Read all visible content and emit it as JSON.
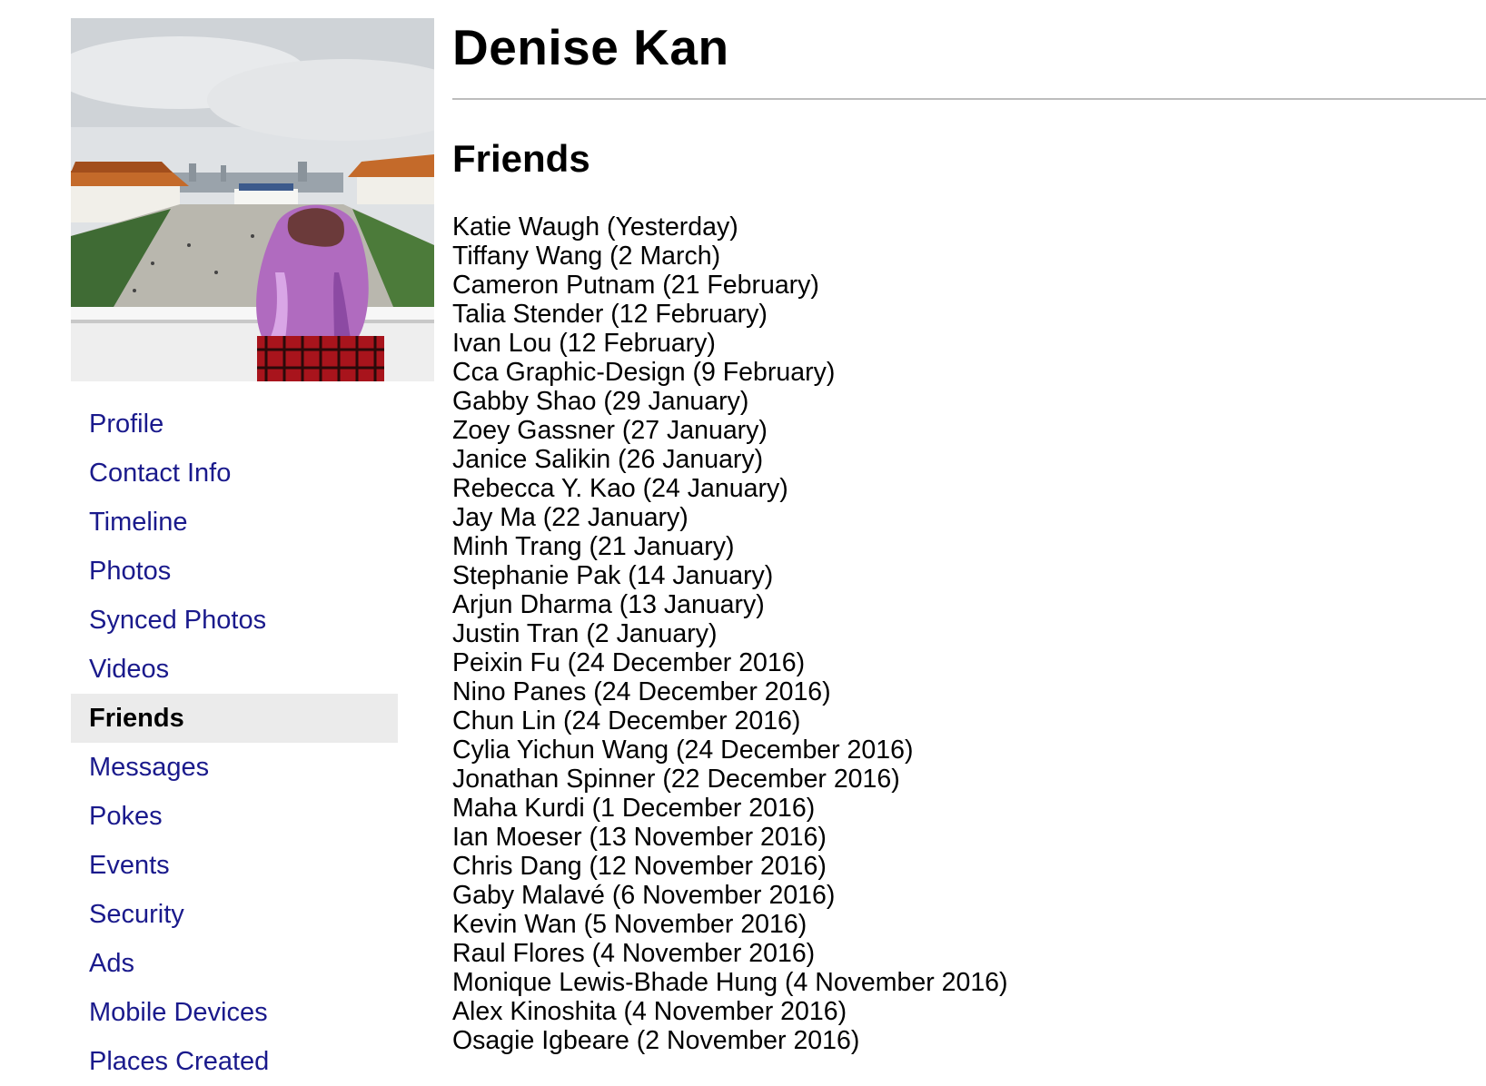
{
  "profile": {
    "name": "Denise Kan",
    "photo_icon": "profile-photo"
  },
  "sidebar": {
    "items": [
      {
        "label": "Profile",
        "active": false
      },
      {
        "label": "Contact Info",
        "active": false
      },
      {
        "label": "Timeline",
        "active": false
      },
      {
        "label": "Photos",
        "active": false
      },
      {
        "label": "Synced Photos",
        "active": false
      },
      {
        "label": "Videos",
        "active": false
      },
      {
        "label": "Friends",
        "active": true
      },
      {
        "label": "Messages",
        "active": false
      },
      {
        "label": "Pokes",
        "active": false
      },
      {
        "label": "Events",
        "active": false
      },
      {
        "label": "Security",
        "active": false
      },
      {
        "label": "Ads",
        "active": false
      },
      {
        "label": "Mobile Devices",
        "active": false
      },
      {
        "label": "Places Created",
        "active": false
      }
    ],
    "link_color": "#1a1a8c",
    "active_bg": "#ebebeb"
  },
  "section": {
    "title": "Friends"
  },
  "friends": [
    "Katie Waugh (Yesterday)",
    "Tiffany Wang (2 March)",
    "Cameron Putnam (21 February)",
    "Talia Stender (12 February)",
    "Ivan Lou (12 February)",
    "Cca Graphic-Design (9 February)",
    "Gabby Shao (29 January)",
    "Zoey Gassner (27 January)",
    "Janice Salikin (26 January)",
    "Rebecca Y. Kao (24 January)",
    "Jay Ma (22 January)",
    "Minh Trang (21 January)",
    "Stephanie Pak (14 January)",
    "Arjun Dharma (13 January)",
    "Justin Tran (2 January)",
    "Peixin Fu (24 December 2016)",
    "Nino Panes (24 December 2016)",
    "Chun Lin (24 December 2016)",
    "Cylia Yichun Wang (24 December 2016)",
    "Jonathan Spinner (22 December 2016)",
    "Maha Kurdi (1 December 2016)",
    "Ian Moeser (13 November 2016)",
    "Chris Dang (12 November 2016)",
    "Gaby Malavé (6 November 2016)",
    "Kevin Wan (5 November 2016)",
    "Raul Flores (4 November 2016)",
    "Monique Lewis-Bhade Hung (4 November 2016)",
    "Alex Kinoshita (4 November 2016)",
    "Osagie Igbeare (2 November 2016)"
  ]
}
